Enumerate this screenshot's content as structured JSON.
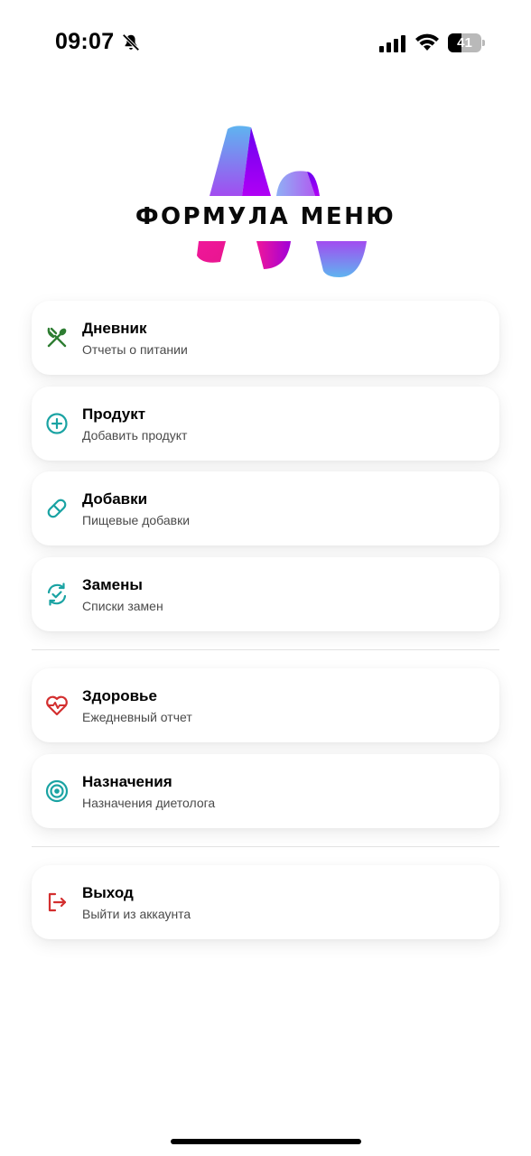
{
  "status_bar": {
    "time": "09:07",
    "battery_level": "41",
    "icons": [
      "bell-slash-icon",
      "signal-icon",
      "wifi-icon",
      "battery-icon"
    ]
  },
  "logo": {
    "text": "ФОРМУЛА МЕНЮ",
    "colors": {
      "pink": "#f0179a",
      "violet": "#8a00f5",
      "blue": "#5fb4f0"
    }
  },
  "menu": {
    "groups": [
      [
        {
          "title": "Дневник",
          "subtitle": "Отчеты о питании",
          "icon": "fork-spoon-icon",
          "color": "#2e7d32"
        },
        {
          "title": "Продукт",
          "subtitle": "Добавить продукт",
          "icon": "plus-circle-icon",
          "color": "#1aa3a3"
        },
        {
          "title": "Добавки",
          "subtitle": "Пищевые добавки",
          "icon": "pill-icon",
          "color": "#1aa3a3"
        },
        {
          "title": "Замены",
          "subtitle": "Списки замен",
          "icon": "refresh-check-icon",
          "color": "#1aa3a3"
        }
      ],
      [
        {
          "title": "Здоровье",
          "subtitle": "Ежедневный отчет",
          "icon": "heart-pulse-icon",
          "color": "#d32f2f"
        },
        {
          "title": "Назначения",
          "subtitle": "Назначения диетолога",
          "icon": "target-icon",
          "color": "#1aa3a3"
        }
      ],
      [
        {
          "title": "Выход",
          "subtitle": "Выйти из аккаунта",
          "icon": "logout-icon",
          "color": "#d32f2f"
        }
      ]
    ]
  }
}
